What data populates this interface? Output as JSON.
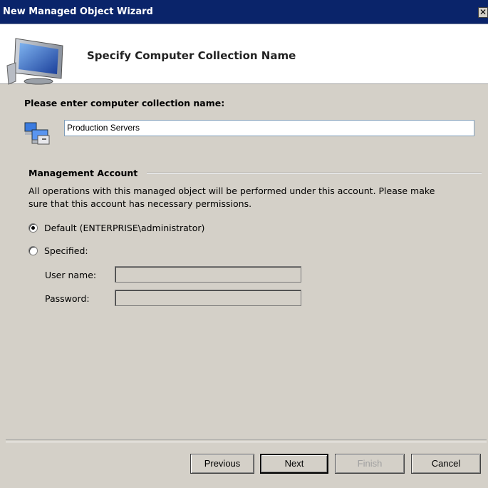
{
  "window": {
    "title": "New Managed Object Wizard",
    "close_glyph": "✕"
  },
  "header": {
    "title": "Specify Computer Collection Name",
    "icon": "computer-monitor-icon"
  },
  "form": {
    "prompt": "Please enter computer collection name:",
    "collection_icon": "server-group-icon",
    "collection_name": "Production Servers"
  },
  "account": {
    "section_title": "Management Account",
    "description_line1": "All operations with this managed object will be performed under this account. Please make",
    "description_line2": "sure that this account has necessary permissions.",
    "options": [
      {
        "label": "Default (ENTERPRISE\\administrator)",
        "selected": true
      },
      {
        "label": "Specified:",
        "selected": false
      }
    ],
    "username_label": "User name:",
    "password_label": "Password:",
    "username_value": "",
    "password_value": ""
  },
  "buttons": {
    "previous": "Previous",
    "next": "Next",
    "finish": "Finish",
    "cancel": "Cancel"
  },
  "colors": {
    "titlebar": "#0a246a",
    "dialog_bg": "#d4d0c8"
  }
}
